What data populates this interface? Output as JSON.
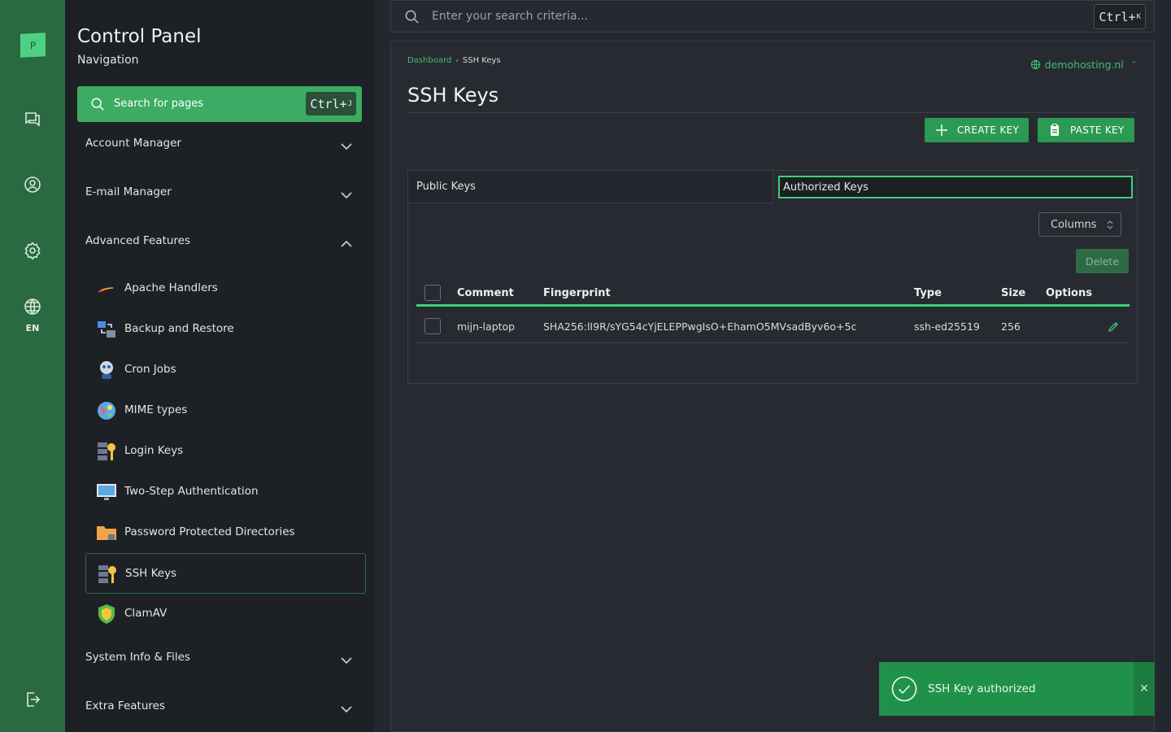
{
  "rail": {
    "logo": "P",
    "icons": [
      "chat-icon",
      "user-circle-icon",
      "gear-icon",
      "globe-icon",
      "logout-icon"
    ],
    "language": "EN"
  },
  "sidebar": {
    "title": "Control Panel",
    "subtitle": "Navigation",
    "search": {
      "placeholder": "Search for pages",
      "shortcut": "Ctrl+",
      "shortcut_key": "J"
    },
    "sections": [
      {
        "label": "Account Manager",
        "expanded": false
      },
      {
        "label": "E-mail Manager",
        "expanded": false
      },
      {
        "label": "Advanced Features",
        "expanded": true
      },
      {
        "label": "System Info & Files",
        "expanded": false
      },
      {
        "label": "Extra Features",
        "expanded": false
      }
    ],
    "items": [
      {
        "label": "Apache Handlers",
        "icon": "feather-icon"
      },
      {
        "label": "Backup and Restore",
        "icon": "backup-icon"
      },
      {
        "label": "Cron Jobs",
        "icon": "robot-icon"
      },
      {
        "label": "MIME types",
        "icon": "mime-icon"
      },
      {
        "label": "Login Keys",
        "icon": "server-key-icon"
      },
      {
        "label": "Two-Step Authentication",
        "icon": "monitor-icon"
      },
      {
        "label": "Password Protected Directories",
        "icon": "folder-lock-icon"
      },
      {
        "label": "SSH Keys",
        "icon": "server-key-icon",
        "active": true
      },
      {
        "label": "ClamAV",
        "icon": "shield-icon"
      }
    ]
  },
  "topbar": {
    "search_placeholder": "Enter your search criteria...",
    "shortcut": "Ctrl+",
    "shortcut_key": "K"
  },
  "main": {
    "breadcrumb": [
      "Dashboard",
      "SSH Keys"
    ],
    "domain": "demohosting.nl",
    "title": "SSH Keys",
    "buttons": {
      "create": "CREATE KEY",
      "paste": "PASTE KEY"
    },
    "tabs": [
      {
        "label": "Public Keys",
        "active": false
      },
      {
        "label": "Authorized Keys",
        "active": true
      }
    ],
    "columns_button": "Columns",
    "delete_button": "Delete",
    "table": {
      "headers": [
        "Comment",
        "Fingerprint",
        "Type",
        "Size",
        "Options"
      ],
      "rows": [
        {
          "comment": "mijn-laptop",
          "fingerprint": "SHA256:lI9R/sYG54cYjELEPPwgIsO+EhamO5MVsadByv6o+5c",
          "type": "ssh-ed25519",
          "size": "256"
        }
      ]
    }
  },
  "toast": {
    "message": "SSH Key authorized",
    "close": "✕"
  },
  "colors": {
    "rail": "#2a6a41",
    "sidebar": "#1d2025",
    "accent": "#3fcf7c",
    "button": "#2b9a53",
    "background": "#23272e"
  }
}
